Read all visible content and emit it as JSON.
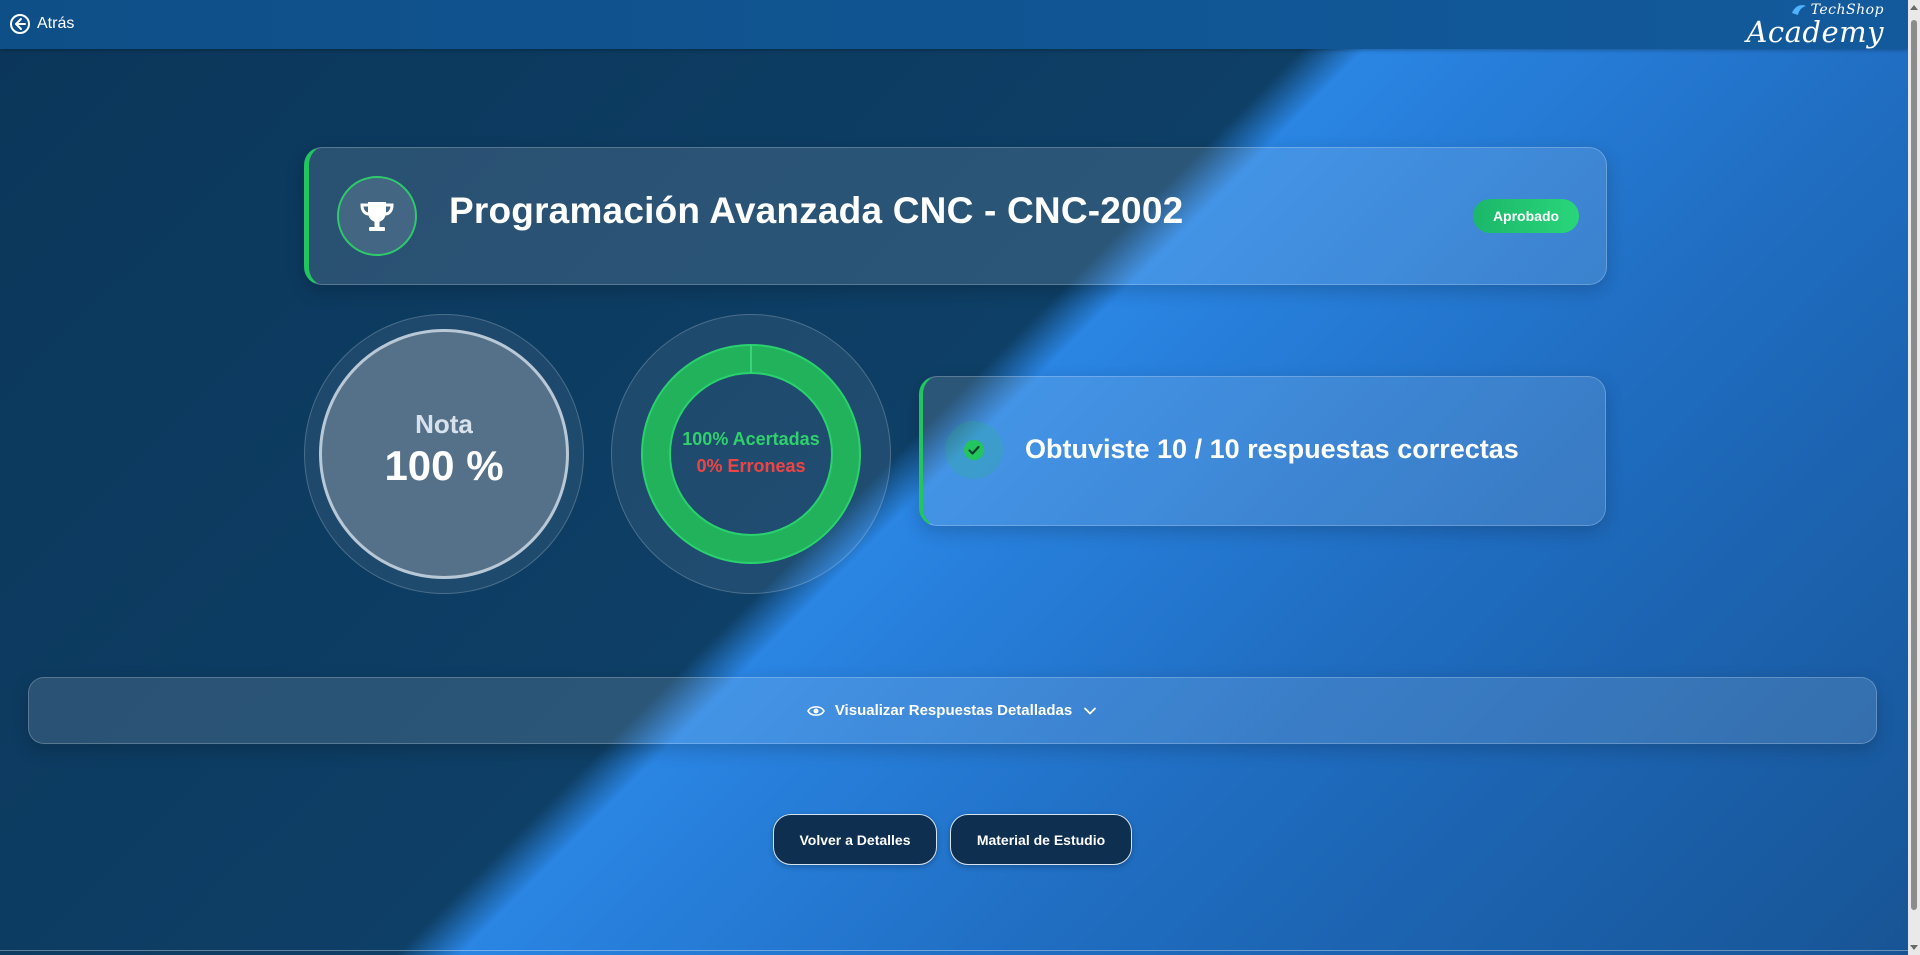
{
  "header": {
    "back_label": "Atrás",
    "logo": {
      "small": "TechShop",
      "big": "Academy"
    }
  },
  "course": {
    "title": "Programación Avanzada CNC - CNC-2002",
    "status": "Aprobado",
    "status_color": "#22c55e"
  },
  "grade": {
    "label": "Nota",
    "value": "100 %"
  },
  "answers": {
    "correct_fraction": 1.0,
    "correct_label": "100% Acertadas",
    "wrong_label": "0% Erroneas",
    "correct_color": "#22c55e",
    "wrong_color": "#ef4444"
  },
  "result": {
    "prefix": "Obtuviste ",
    "score": "10 / 10",
    "suffix": " respuestas correctas"
  },
  "details_toggle": {
    "label": "Visualizar Respuestas Detalladas"
  },
  "actions": {
    "back_to_details": "Volver a Detalles",
    "study_material": "Material de Estudio"
  },
  "icons": {
    "back": "arrow-left-circle-icon",
    "trophy": "trophy-icon",
    "check": "check-circle-icon",
    "eye": "eye-icon",
    "chevron": "chevron-down-icon"
  }
}
